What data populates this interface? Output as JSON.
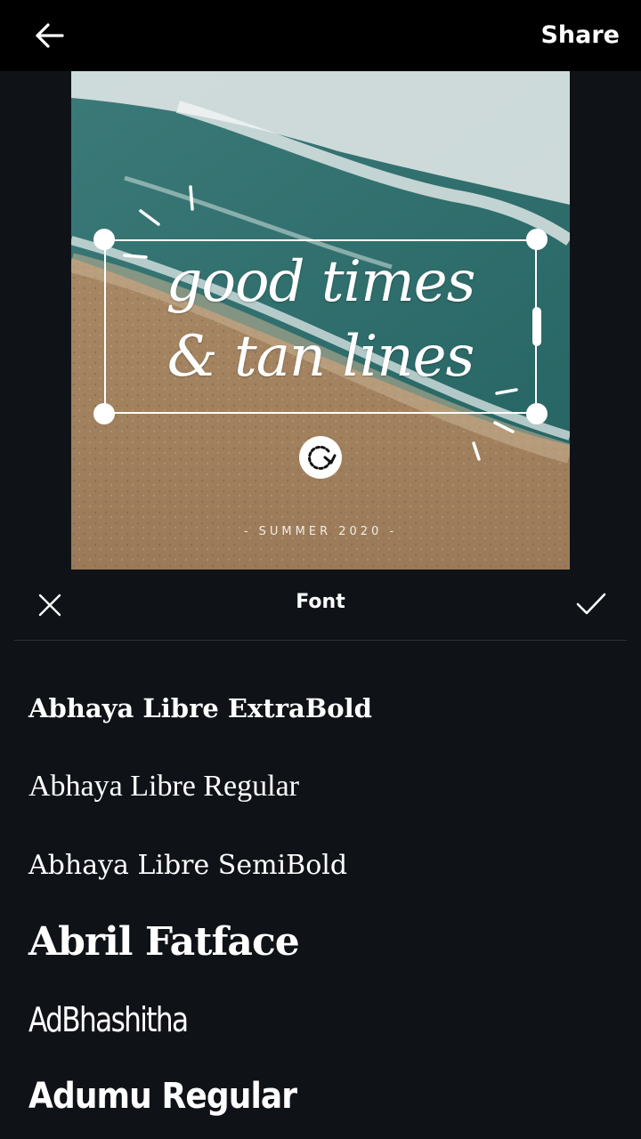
{
  "topbar": {
    "back_icon": "arrow-left-icon",
    "share_label": "Share"
  },
  "design": {
    "headline_line1": "good times",
    "headline_line2": "& tan lines",
    "tagline": "- SUMMER 2020 -",
    "rotate_icon": "rotate-icon",
    "colors": {
      "sea": "#2f6e6e",
      "sand": "#a48463",
      "foam": "#e9ecec"
    }
  },
  "sheet": {
    "title": "Font",
    "close_icon": "close-icon",
    "confirm_icon": "checkmark-icon"
  },
  "fonts": [
    "Abhaya Libre ExtraBold",
    "Abhaya Libre Regular",
    "Abhaya Libre SemiBold",
    "Abril Fatface",
    "AdBhashitha",
    "Adumu Regular"
  ],
  "colors": {
    "background": "#0f1318",
    "topbar": "#000000",
    "text": "#ffffff"
  }
}
